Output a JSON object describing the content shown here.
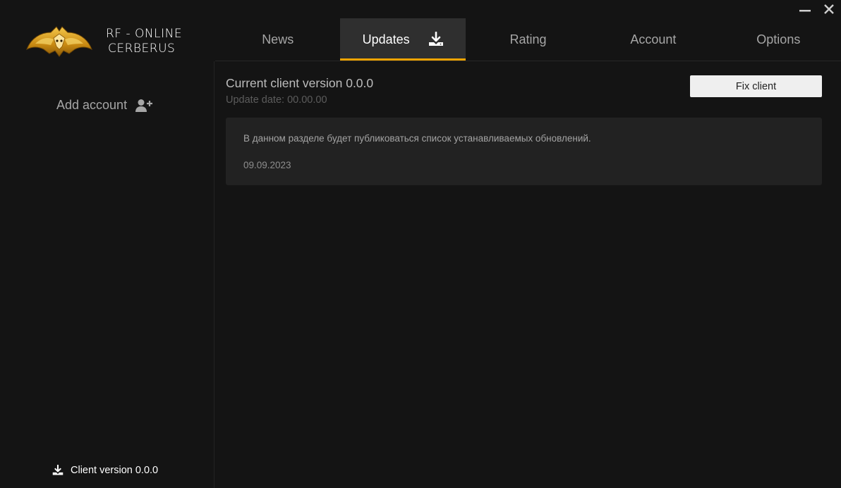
{
  "window": {
    "minimize_label": "minimize",
    "close_label": "close"
  },
  "logo": {
    "line1": "RF - ONLINE",
    "line2": "CERBERUS",
    "accent_color": "#e8a317"
  },
  "tabs": [
    {
      "label": "News",
      "active": false
    },
    {
      "label": "Updates",
      "active": true,
      "icon": "download-icon"
    },
    {
      "label": "Rating",
      "active": false
    },
    {
      "label": "Account",
      "active": false
    },
    {
      "label": "Options",
      "active": false
    }
  ],
  "sidebar": {
    "add_account_label": "Add account",
    "add_account_icon": "add-user-icon",
    "client_version_label": "Client version 0.0.0",
    "client_version_icon": "download-icon"
  },
  "main": {
    "version_title": "Current client version 0.0.0",
    "update_date": "Update date: 00.00.00",
    "fix_button_label": "Fix client",
    "updates": [
      {
        "text": "В данном разделе будет публиковаться список устанавливаемых обновлений.",
        "date": "09.09.2023"
      }
    ]
  },
  "colors": {
    "background": "#141414",
    "active_tab": "#2f2f2f",
    "active_tab_underline": "#f0a400",
    "card": "#222222",
    "button": "#efefef"
  }
}
